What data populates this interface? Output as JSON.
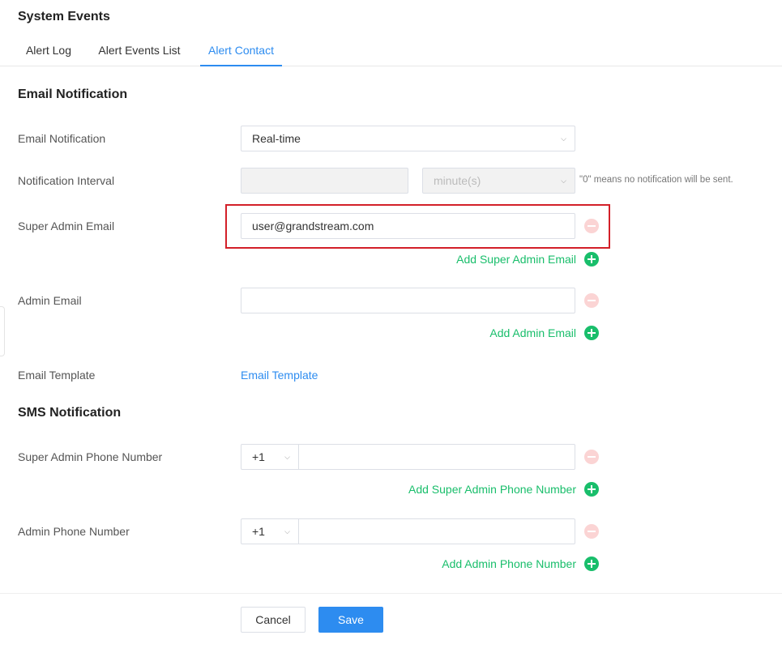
{
  "page": {
    "title": "System Events"
  },
  "tabs": [
    {
      "label": "Alert Log"
    },
    {
      "label": "Alert Events List"
    },
    {
      "label": "Alert Contact"
    }
  ],
  "email_section": {
    "title": "Email Notification",
    "notification_label": "Email Notification",
    "notification_value": "Real-time",
    "interval_label": "Notification Interval",
    "interval_value": "",
    "interval_unit": "minute(s)",
    "interval_hint": "\"0\" means no notification will be sent.",
    "super_admin_label": "Super Admin Email",
    "super_admin_value": "user@grandstream.com",
    "add_super_admin": "Add Super Admin Email",
    "admin_label": "Admin Email",
    "admin_value": "",
    "add_admin": "Add Admin Email",
    "template_label": "Email Template",
    "template_link": "Email Template"
  },
  "sms_section": {
    "title": "SMS Notification",
    "super_admin_label": "Super Admin Phone Number",
    "super_admin_code": "+1",
    "super_admin_value": "",
    "add_super_admin": "Add Super Admin Phone Number",
    "admin_label": "Admin Phone Number",
    "admin_code": "+1",
    "admin_value": "",
    "add_admin": "Add Admin Phone Number"
  },
  "footer": {
    "cancel_label": "Cancel",
    "save_label": "Save"
  },
  "icons": {
    "chevron": "chevron-down-icon",
    "remove": "remove-circle-icon",
    "add": "add-circle-icon"
  },
  "colors": {
    "accent": "#2d8cf0",
    "add_green": "#19be6b",
    "remove_pink": "#fbd4d4",
    "highlight_red": "#d32029"
  }
}
